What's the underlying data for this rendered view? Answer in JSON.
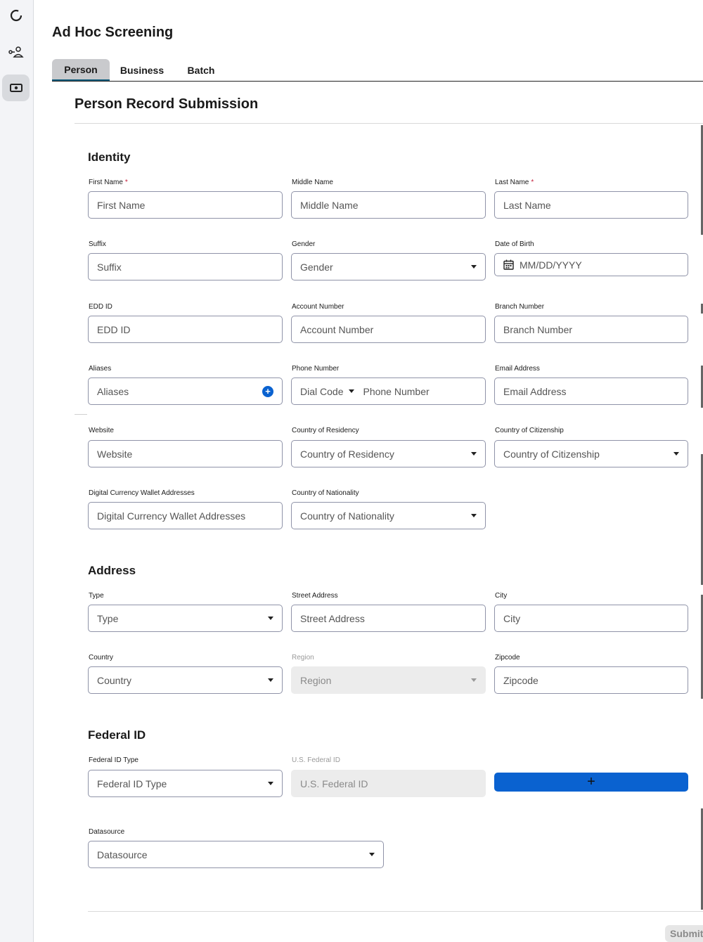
{
  "page_title": "Ad Hoc Screening",
  "tabs": [
    {
      "label": "Person",
      "active": true
    },
    {
      "label": "Business",
      "active": false
    },
    {
      "label": "Batch",
      "active": false
    }
  ],
  "form_title": "Person Record Submission",
  "sections": {
    "identity": "Identity",
    "address": "Address",
    "federal_id": "Federal ID"
  },
  "fields": {
    "first_name": {
      "label": "First Name",
      "placeholder": "First Name",
      "required": "*"
    },
    "middle_name": {
      "label": "Middle Name",
      "placeholder": "Middle Name"
    },
    "last_name": {
      "label": "Last Name",
      "placeholder": "Last Name",
      "required": "*"
    },
    "suffix": {
      "label": "Suffix",
      "placeholder": "Suffix"
    },
    "gender": {
      "label": "Gender",
      "placeholder": "Gender"
    },
    "dob": {
      "label": "Date of Birth",
      "placeholder": "MM/DD/YYYY"
    },
    "edd_id": {
      "label": "EDD ID",
      "placeholder": "EDD ID"
    },
    "account_number": {
      "label": "Account Number",
      "placeholder": "Account Number"
    },
    "branch_number": {
      "label": "Branch Number",
      "placeholder": "Branch Number"
    },
    "aliases": {
      "label": "Aliases",
      "placeholder": "Aliases"
    },
    "phone": {
      "label": "Phone Number",
      "dial_code": "Dial Code",
      "placeholder": "Phone Number"
    },
    "email": {
      "label": "Email Address",
      "placeholder": "Email Address"
    },
    "website": {
      "label": "Website",
      "placeholder": "Website"
    },
    "country_residency": {
      "label": "Country of Residency",
      "placeholder": "Country of Residency"
    },
    "country_citizenship": {
      "label": "Country of Citizenship",
      "placeholder": "Country of Citizenship"
    },
    "wallet": {
      "label": "Digital Currency Wallet Addresses",
      "placeholder": "Digital Currency Wallet Addresses"
    },
    "country_nationality": {
      "label": "Country of Nationality",
      "placeholder": "Country of Nationality"
    },
    "addr_type": {
      "label": "Type",
      "placeholder": "Type"
    },
    "street": {
      "label": "Street Address",
      "placeholder": "Street Address"
    },
    "city": {
      "label": "City",
      "placeholder": "City"
    },
    "country": {
      "label": "Country",
      "placeholder": "Country"
    },
    "region": {
      "label": "Region",
      "placeholder": "Region"
    },
    "zipcode": {
      "label": "Zipcode",
      "placeholder": "Zipcode"
    },
    "federal_id_type": {
      "label": "Federal ID Type",
      "placeholder": "Federal ID Type"
    },
    "us_federal_id": {
      "label": "U.S. Federal ID",
      "placeholder": "U.S. Federal ID"
    },
    "datasource": {
      "label": "Datasource",
      "placeholder": "Datasource"
    }
  },
  "add_button": "+",
  "submit_label": "Submit",
  "icons": {
    "sidebar": [
      "loading-ring-icon",
      "person-link-icon",
      "id-card-icon"
    ]
  },
  "colors": {
    "accent": "#0a62d0",
    "required": "#c41e3a",
    "tab_active": "#c9cacd"
  }
}
